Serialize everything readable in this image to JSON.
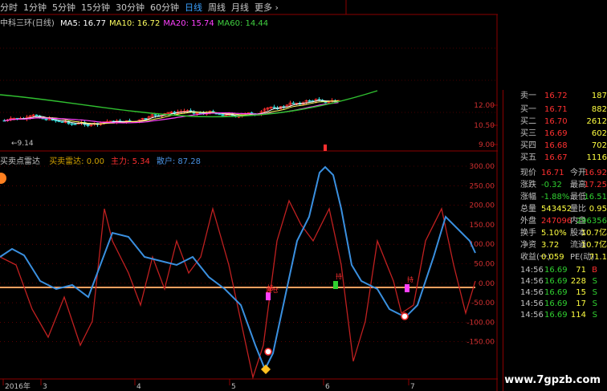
{
  "tabs": [
    "分时",
    "1分钟",
    "5分钟",
    "15分钟",
    "30分钟",
    "60分钟",
    "日线",
    "周线",
    "月线",
    "更多 ›"
  ],
  "active_tab": "日线",
  "main_chart": {
    "name": "中科三环(日线)",
    "ma": [
      {
        "label": "MA5: 16.77",
        "color": "#ffffff"
      },
      {
        "label": "MA10: 16.72",
        "color": "#ffff60"
      },
      {
        "label": "MA20: 15.74",
        "color": "#ff40ff"
      },
      {
        "label": "MA60: 14.44",
        "color": "#40d040"
      }
    ],
    "y_ticks": [
      "12.00",
      "10.50",
      "9.00"
    ],
    "low_marker": "9.14"
  },
  "indicator": {
    "name": "买卖点雷达",
    "params": [
      {
        "label": "买卖雷达: 0.00",
        "color": "#d0a000"
      },
      {
        "label": "主力: 5.34",
        "color": "#ff3030"
      },
      {
        "label": "散户: 87.28",
        "color": "#4a90e0"
      }
    ],
    "y_ticks": [
      "300.00",
      "250.00",
      "200.00",
      "150.00",
      "100.00",
      "50.00",
      "0.00",
      "-50.00",
      "-100.00",
      "-150.00"
    ],
    "signals": [
      "建仓",
      "持",
      "持",
      "持"
    ]
  },
  "x_axis": {
    "labels": [
      "2016年",
      "3",
      "4",
      "5",
      "6",
      "7"
    ]
  },
  "quote": {
    "sell": [
      {
        "label": "卖一",
        "price": "16.72",
        "vol": "187"
      }
    ],
    "buy": [
      {
        "label": "买一",
        "price": "16.71",
        "vol": "882"
      },
      {
        "label": "买二",
        "price": "16.70",
        "vol": "2612"
      },
      {
        "label": "买三",
        "price": "16.69",
        "vol": "602"
      },
      {
        "label": "买四",
        "price": "16.68",
        "vol": "702"
      },
      {
        "label": "买五",
        "price": "16.67",
        "vol": "1116"
      }
    ],
    "stats": [
      {
        "l1": "现价",
        "v1": "16.71",
        "l2": "今开",
        "v2": "16.92",
        "c1": "#ff3030",
        "c2": "#ff3030"
      },
      {
        "l1": "涨跌",
        "v1": "-0.32",
        "l2": "最高",
        "v2": "17.25",
        "c1": "#30d030",
        "c2": "#ff3030"
      },
      {
        "l1": "涨幅",
        "v1": "-1.88%",
        "l2": "最低",
        "v2": "16.51",
        "c1": "#30d030",
        "c2": "#30d030"
      },
      {
        "l1": "总量",
        "v1": "543452",
        "l2": "量比",
        "v2": "0.95",
        "c1": "#ffff40",
        "c2": "#ffff40"
      },
      {
        "l1": "外盘",
        "v1": "247096",
        "l2": "内盘",
        "v2": "296356",
        "c1": "#ff3030",
        "c2": "#30d030"
      },
      {
        "l1": "换手",
        "v1": "5.10%",
        "l2": "股本",
        "v2": "10.7亿",
        "c1": "#ffff40",
        "c2": "#ffff40"
      },
      {
        "l1": "净资",
        "v1": "3.72",
        "l2": "流通",
        "v2": "10.7亿",
        "c1": "#ffff40",
        "c2": "#ffff40"
      },
      {
        "l1": "收益(一)",
        "v1": "0.059",
        "l2": "PE(动)",
        "v2": "71.1",
        "c1": "#ffff40",
        "c2": "#ffff40"
      }
    ],
    "ticks": [
      {
        "time": "14:56",
        "price": "16.69",
        "vol": "71",
        "side": "B"
      },
      {
        "time": "14:56",
        "price": "16.69",
        "vol": "228",
        "side": "S"
      },
      {
        "time": "14:56",
        "price": "16.69",
        "vol": "15",
        "side": "S"
      },
      {
        "time": "14:56",
        "price": "16.69",
        "vol": "17",
        "side": "S"
      },
      {
        "time": "14:56",
        "price": "16.69",
        "vol": "114",
        "side": "S"
      }
    ]
  },
  "watermark": "www.7gpzb.com",
  "colors": {
    "up": "#ff3030",
    "down": "#30d030",
    "grid": "#8b0000",
    "blue": "#3aa0ff"
  }
}
